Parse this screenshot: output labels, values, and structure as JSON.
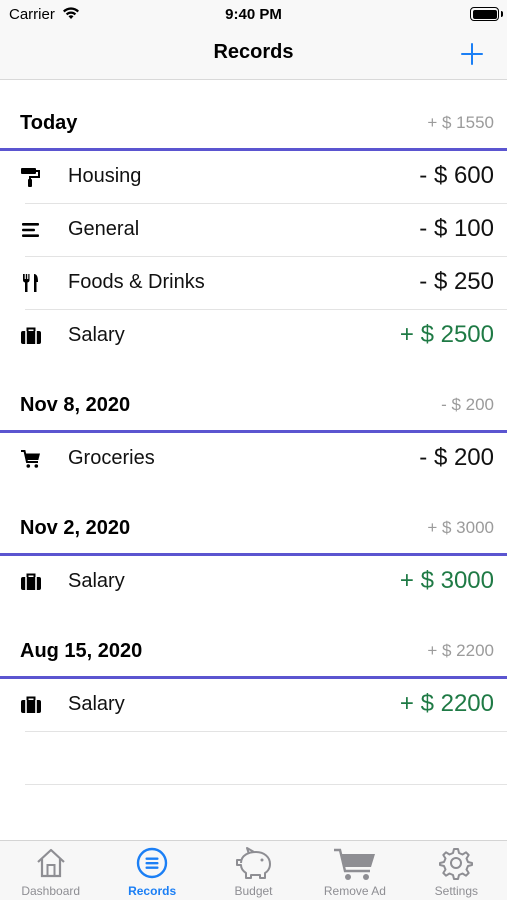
{
  "status_bar": {
    "carrier": "Carrier",
    "time": "9:40 PM"
  },
  "nav": {
    "title": "Records"
  },
  "sections": [
    {
      "date": "Today",
      "total": "+ $ 1550",
      "records": [
        {
          "icon": "paint-roller-icon",
          "label": "Housing",
          "amount": "- $ 600",
          "type": "expense"
        },
        {
          "icon": "list-icon",
          "label": "General",
          "amount": "- $ 100",
          "type": "expense"
        },
        {
          "icon": "utensils-icon",
          "label": "Foods & Drinks",
          "amount": "- $ 250",
          "type": "expense"
        },
        {
          "icon": "briefcase-icon",
          "label": "Salary",
          "amount": "+ $ 2500",
          "type": "income"
        }
      ]
    },
    {
      "date": "Nov 8, 2020",
      "total": "- $ 200",
      "records": [
        {
          "icon": "shopping-cart-icon",
          "label": "Groceries",
          "amount": "- $ 200",
          "type": "expense"
        }
      ]
    },
    {
      "date": "Nov 2, 2020",
      "total": "+ $ 3000",
      "records": [
        {
          "icon": "briefcase-icon",
          "label": "Salary",
          "amount": "+ $ 3000",
          "type": "income"
        }
      ]
    },
    {
      "date": "Aug 15, 2020",
      "total": "+ $ 2200",
      "records": [
        {
          "icon": "briefcase-icon",
          "label": "Salary",
          "amount": "+ $ 2200",
          "type": "income"
        }
      ]
    }
  ],
  "tabs": [
    {
      "label": "Dashboard",
      "icon": "home-icon",
      "active": false
    },
    {
      "label": "Records",
      "icon": "list-circle-icon",
      "active": true
    },
    {
      "label": "Budget",
      "icon": "piggy-bank-icon",
      "active": false
    },
    {
      "label": "Remove Ad",
      "icon": "cart-icon",
      "active": false
    },
    {
      "label": "Settings",
      "icon": "gear-icon",
      "active": false
    }
  ],
  "colors": {
    "accent": "#1b7ff5",
    "section_rule": "#5b55d0",
    "income": "#1f7a45",
    "muted": "#9b9b9b"
  }
}
